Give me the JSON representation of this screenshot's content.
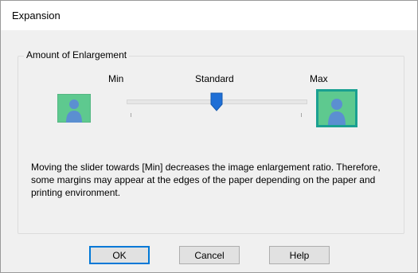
{
  "window": {
    "title": "Expansion"
  },
  "group": {
    "legend": "Amount of Enlargement"
  },
  "slider": {
    "min_label": "Min",
    "standard_label": "Standard",
    "max_label": "Max",
    "position": "Standard"
  },
  "description": "Moving the slider towards [Min] decreases the image enlargement ratio. Therefore, some margins may appear at the edges of the paper depending on the paper and printing environment.",
  "buttons": {
    "ok": "OK",
    "cancel": "Cancel",
    "help": "Help"
  },
  "colors": {
    "thumb_bg": "#5ec98f",
    "person": "#5b8fd1",
    "max_outline": "#1aa091",
    "handle": "#1f6fd6"
  },
  "icons": {
    "min_preview": "person-small-icon",
    "max_preview": "person-large-icon",
    "slider_handle": "slider-thumb-icon"
  }
}
